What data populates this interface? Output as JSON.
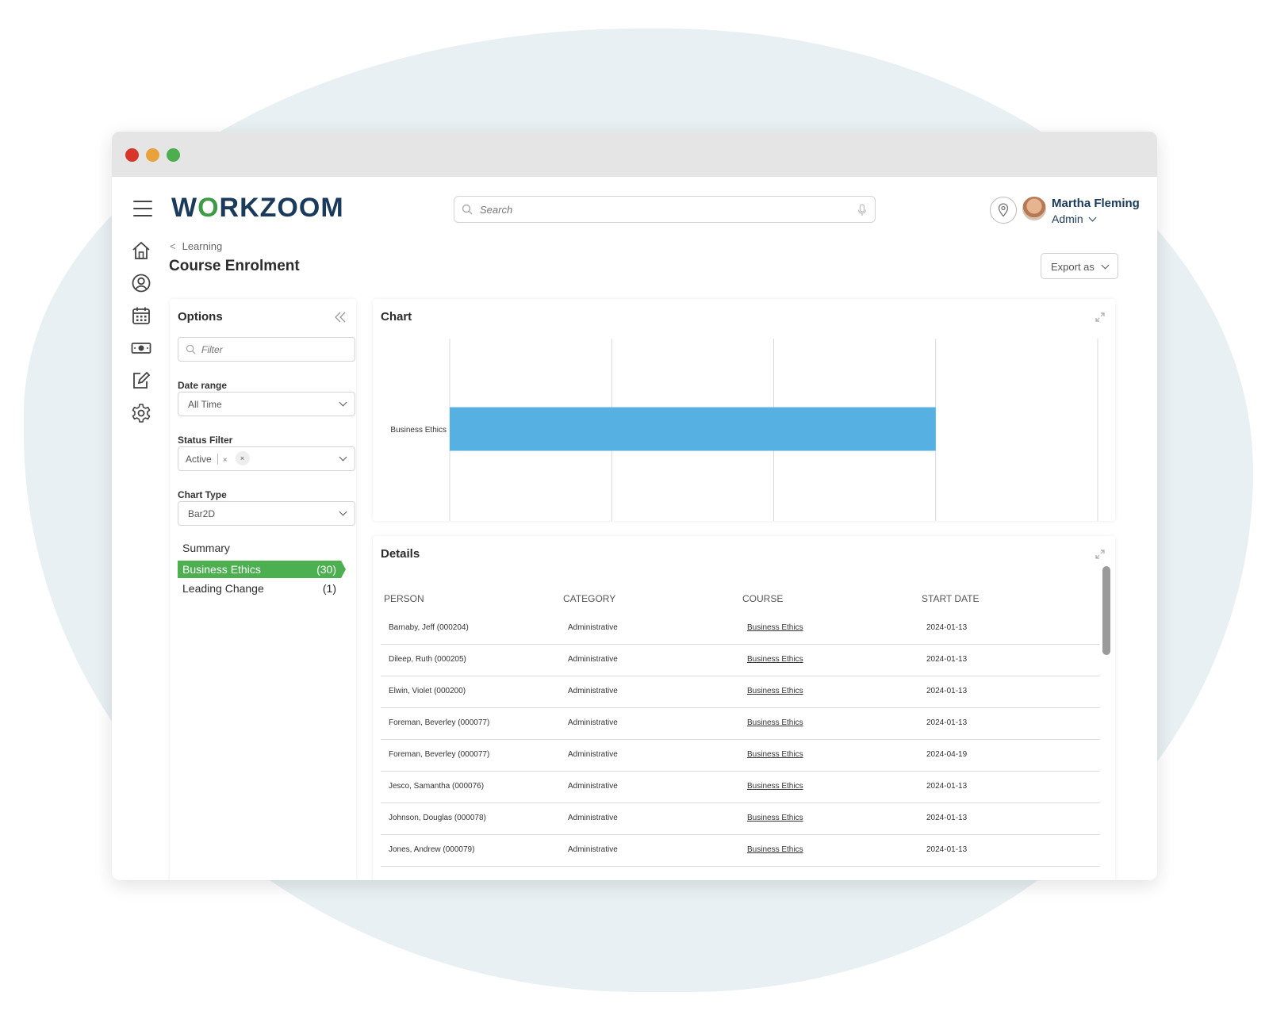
{
  "app": {
    "brand_pre": "W",
    "brand_o": "O",
    "brand_post": "RKZOOM"
  },
  "search": {
    "placeholder": "Search"
  },
  "user": {
    "name": "Martha Fleming",
    "role": "Admin"
  },
  "nav": [
    "home-icon",
    "profile-icon",
    "calendar-icon",
    "payroll-icon",
    "edit-icon",
    "settings-icon"
  ],
  "breadcrumb": {
    "parent": "Learning"
  },
  "page": {
    "title": "Course Enrolment",
    "export_label": "Export as"
  },
  "options": {
    "title": "Options",
    "filter_placeholder": "Filter",
    "date_range_label": "Date range",
    "date_range_value": "All Time",
    "status_filter_label": "Status Filter",
    "status_tag": "Active",
    "status_tag_remove": "×",
    "status_clear": "×",
    "chart_type_label": "Chart Type",
    "chart_type_value": "Bar2D",
    "summary_title": "Summary",
    "summary": [
      {
        "label": "Business Ethics",
        "count": "(30)",
        "active": true
      },
      {
        "label": "Leading Change",
        "count": "(1)",
        "active": false
      }
    ]
  },
  "chart_panel": {
    "title": "Chart"
  },
  "chart_data": {
    "type": "bar",
    "orientation": "horizontal",
    "categories": [
      "Business Ethics"
    ],
    "values": [
      30
    ],
    "xlim": [
      0,
      40
    ],
    "grid": true,
    "colors": {
      "bar": "#56b0e2"
    }
  },
  "details": {
    "title": "Details",
    "columns": [
      "PERSON",
      "CATEGORY",
      "COURSE",
      "START DATE"
    ],
    "rows": [
      [
        "Barnaby, Jeff (000204)",
        "Administrative",
        "Business Ethics",
        "2024-01-13"
      ],
      [
        "Dileep, Ruth (000205)",
        "Administrative",
        "Business Ethics",
        "2024-01-13"
      ],
      [
        "Elwin, Violet (000200)",
        "Administrative",
        "Business Ethics",
        "2024-01-13"
      ],
      [
        "Foreman, Beverley (000077)",
        "Administrative",
        "Business Ethics",
        "2024-01-13"
      ],
      [
        "Foreman, Beverley (000077)",
        "Administrative",
        "Business Ethics",
        "2024-04-19"
      ],
      [
        "Jesco, Samantha (000076)",
        "Administrative",
        "Business Ethics",
        "2024-01-13"
      ],
      [
        "Johnson, Douglas (000078)",
        "Administrative",
        "Business Ethics",
        "2024-01-13"
      ],
      [
        "Jones, Andrew (000079)",
        "Administrative",
        "Business Ethics",
        "2024-01-13"
      ]
    ]
  },
  "colors": {
    "accent_green": "#4caf50",
    "brand_navy": "#1a3a5b",
    "bar_blue": "#56b0e2"
  }
}
